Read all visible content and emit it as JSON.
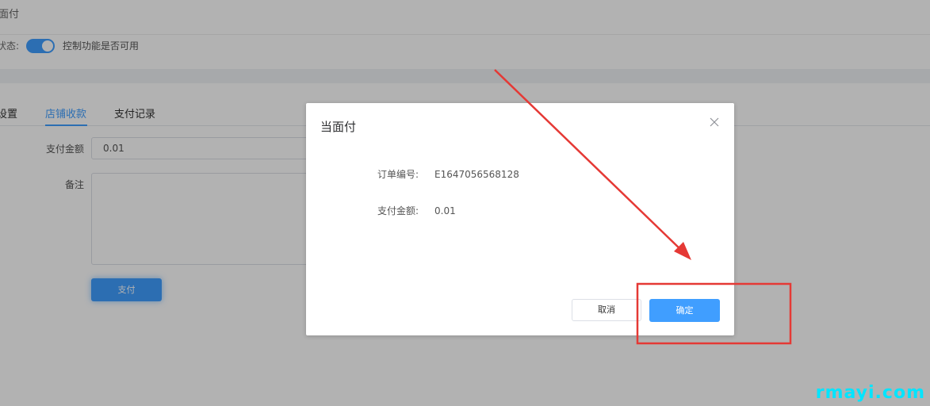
{
  "page": {
    "title": "面付",
    "status_label": "状态:",
    "toggle_description": "控制功能是否可用",
    "toggle_on": true
  },
  "tabs": [
    {
      "label": "设置",
      "active": false
    },
    {
      "label": "店铺收款",
      "active": true
    },
    {
      "label": "支付记录",
      "active": false
    }
  ],
  "form": {
    "amount_label": "支付金额",
    "amount_value": "0.01",
    "remark_label": "备注",
    "remark_value": "",
    "pay_button": "支付"
  },
  "dialog": {
    "title": "当面付",
    "close_icon": "close-icon",
    "order_label": "订单编号:",
    "order_value": "E1647056568128",
    "amount_label": "支付金额:",
    "amount_value": "0.01",
    "cancel_label": "取消",
    "confirm_label": "确定"
  },
  "watermark": "rmayi.com",
  "colors": {
    "accent": "#409eff",
    "annotation": "#e53935",
    "watermark": "#00e5ff"
  }
}
